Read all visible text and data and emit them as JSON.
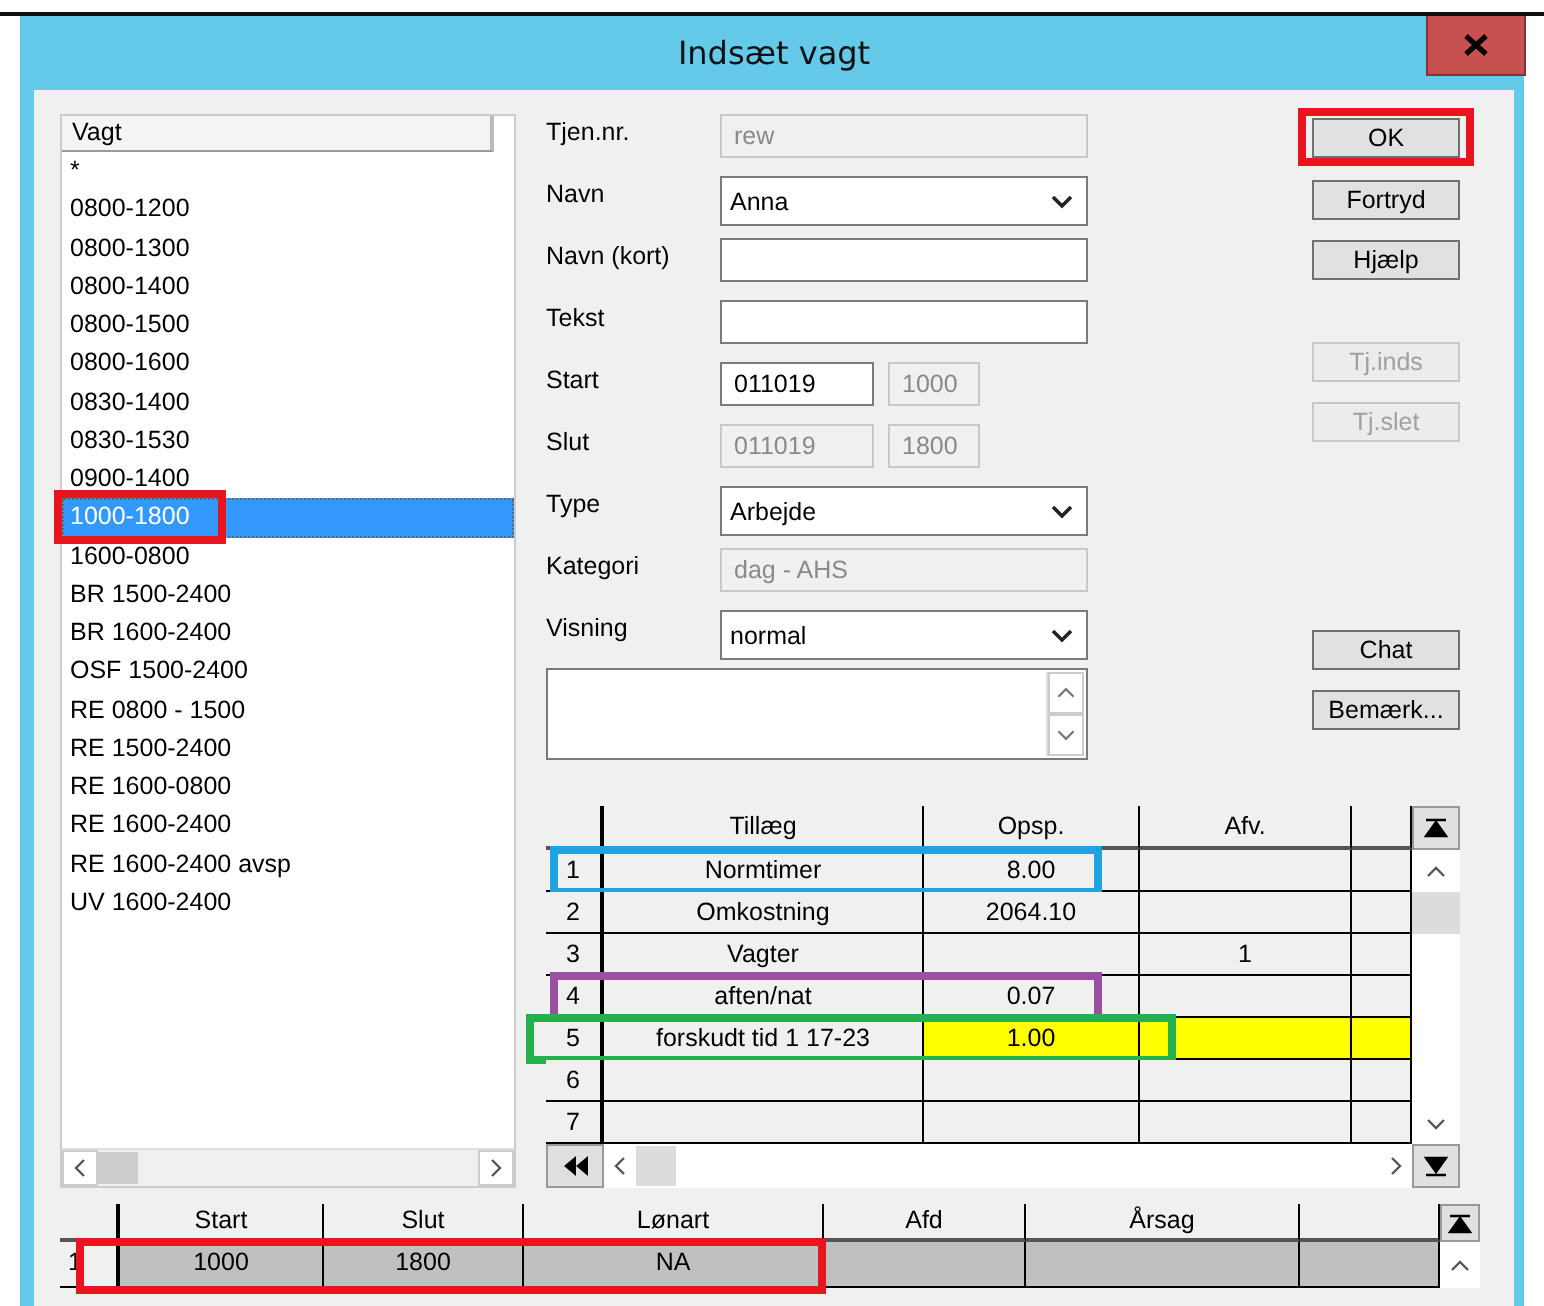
{
  "window": {
    "title": "Indsæt vagt"
  },
  "shift_list": {
    "header": "Vagt",
    "items": [
      {
        "label": "*",
        "selected": false
      },
      {
        "label": "0800-1200",
        "selected": false
      },
      {
        "label": "0800-1300",
        "selected": false
      },
      {
        "label": "0800-1400",
        "selected": false
      },
      {
        "label": "0800-1500",
        "selected": false
      },
      {
        "label": "0800-1600",
        "selected": false
      },
      {
        "label": "0830-1400",
        "selected": false
      },
      {
        "label": "0830-1530",
        "selected": false
      },
      {
        "label": "0900-1400",
        "selected": false
      },
      {
        "label": "1000-1800",
        "selected": true,
        "frame": {
          "color": "#e8141e"
        }
      },
      {
        "label": "1600-0800",
        "selected": false
      },
      {
        "label": "BR 1500-2400",
        "selected": false
      },
      {
        "label": "BR 1600-2400",
        "selected": false
      },
      {
        "label": "OSF 1500-2400",
        "selected": false
      },
      {
        "label": "RE 0800 - 1500",
        "selected": false
      },
      {
        "label": "RE 1500-2400",
        "selected": false
      },
      {
        "label": "RE 1600-0800",
        "selected": false
      },
      {
        "label": "RE 1600-2400",
        "selected": false
      },
      {
        "label": "RE 1600-2400 avsp",
        "selected": false
      },
      {
        "label": "UV 1600-2400",
        "selected": false
      }
    ]
  },
  "form": [
    {
      "label": "Tjen.nr.",
      "kind": "text",
      "value": "rew",
      "disabled": true
    },
    {
      "label": "Navn",
      "kind": "combo",
      "value": "Anna",
      "disabled": false
    },
    {
      "label": "Navn (kort)",
      "kind": "text",
      "disabled": false
    },
    {
      "label": "Tekst",
      "kind": "text",
      "disabled": false
    },
    {
      "label": "Start",
      "kind": "datetime",
      "date": {
        "value": "011019",
        "disabled": false
      },
      "time": {
        "value": "1000",
        "disabled": true
      }
    },
    {
      "label": "Slut",
      "kind": "datetime",
      "date": {
        "value": "011019",
        "disabled": true
      },
      "time": {
        "value": "1800",
        "disabled": true
      }
    },
    {
      "label": "Type",
      "kind": "combo",
      "value": "Arbejde",
      "disabled": false
    },
    {
      "label": "Kategori",
      "kind": "text",
      "value": "dag - AHS",
      "disabled": true
    },
    {
      "label": "Visning",
      "kind": "combo",
      "value": "normal",
      "disabled": false
    }
  ],
  "buttons": [
    [
      {
        "label": "OK",
        "disabled": false,
        "frame": {
          "color": "#e8141e"
        }
      },
      {
        "label": "Fortryd",
        "disabled": false
      },
      {
        "label": "Hjælp",
        "disabled": false
      }
    ],
    [
      {
        "label": "Tj.inds",
        "disabled": true
      },
      {
        "label": "Tj.slet",
        "disabled": true
      }
    ],
    [
      {
        "label": "Chat",
        "disabled": false
      },
      {
        "label": "Bemærk...",
        "disabled": false
      }
    ]
  ],
  "supplement_grid": {
    "columns": [
      "Tillæg",
      "Opsp.",
      "Afv."
    ],
    "rows": [
      {
        "number": "1",
        "cells": [
          "Normtimer",
          "8.00",
          ""
        ],
        "flagged": false,
        "frame": {
          "color": "#1fa3e0",
          "kind": "short"
        }
      },
      {
        "number": "2",
        "cells": [
          "Omkostning",
          "2064.10",
          ""
        ],
        "flagged": false
      },
      {
        "number": "3",
        "cells": [
          "Vagter",
          "",
          "1"
        ],
        "flagged": false
      },
      {
        "number": "4",
        "cells": [
          "aften/nat",
          "0.07",
          ""
        ],
        "flagged": false,
        "frame": {
          "color": "#9b4fa0",
          "kind": "short"
        }
      },
      {
        "number": "5",
        "cells": [
          "forskudt tid 1 17-23",
          "1.00",
          ""
        ],
        "flagged": true,
        "frame": {
          "color": "#22b14c",
          "kind": "long"
        }
      },
      {
        "number": "6",
        "cells": [
          "",
          "",
          ""
        ],
        "flagged": false
      },
      {
        "number": "7",
        "cells": [
          "",
          "",
          ""
        ],
        "flagged": false
      }
    ]
  },
  "shift_grid": {
    "columns": [
      "Start",
      "Slut",
      "Lønart",
      "Afd",
      "Årsag"
    ],
    "rows": [
      {
        "number": "1",
        "cells": [
          "1000",
          "1800",
          "NA",
          "",
          ""
        ],
        "selected": true,
        "frame": {
          "color": "#e8141e"
        }
      }
    ]
  }
}
